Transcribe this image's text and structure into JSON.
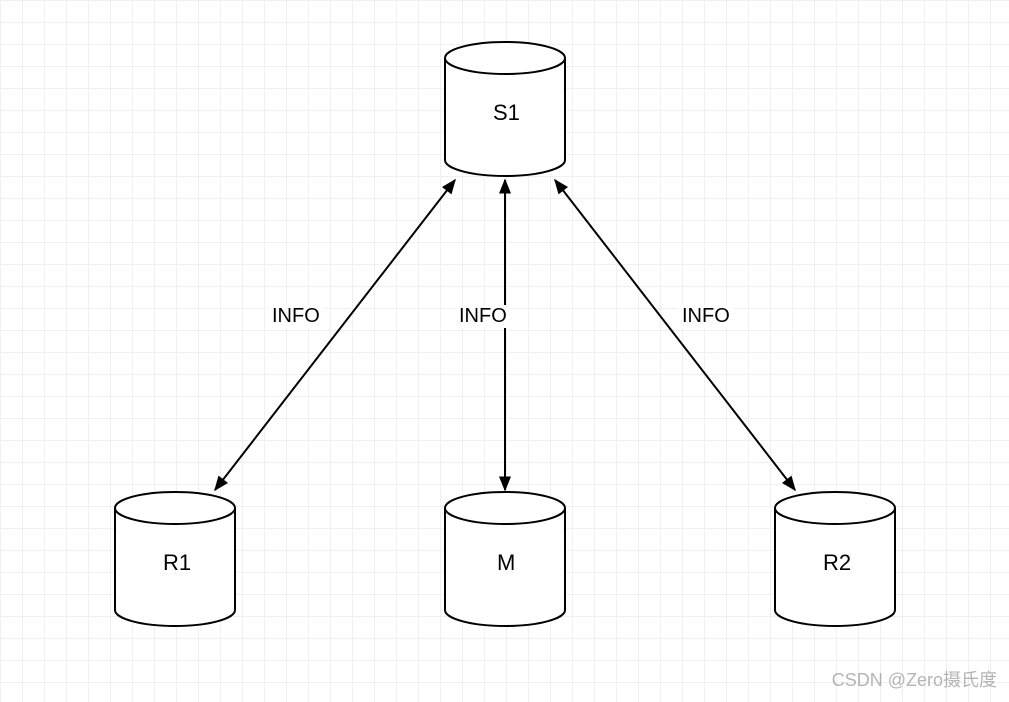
{
  "nodes": {
    "top": {
      "label": "S1"
    },
    "left": {
      "label": "R1"
    },
    "mid": {
      "label": "M"
    },
    "right": {
      "label": "R2"
    }
  },
  "edges": {
    "left_top": {
      "label": "INFO"
    },
    "mid_top": {
      "label": "INFO"
    },
    "right_top": {
      "label": "INFO"
    }
  },
  "watermark": "CSDN @Zero摄氏度"
}
